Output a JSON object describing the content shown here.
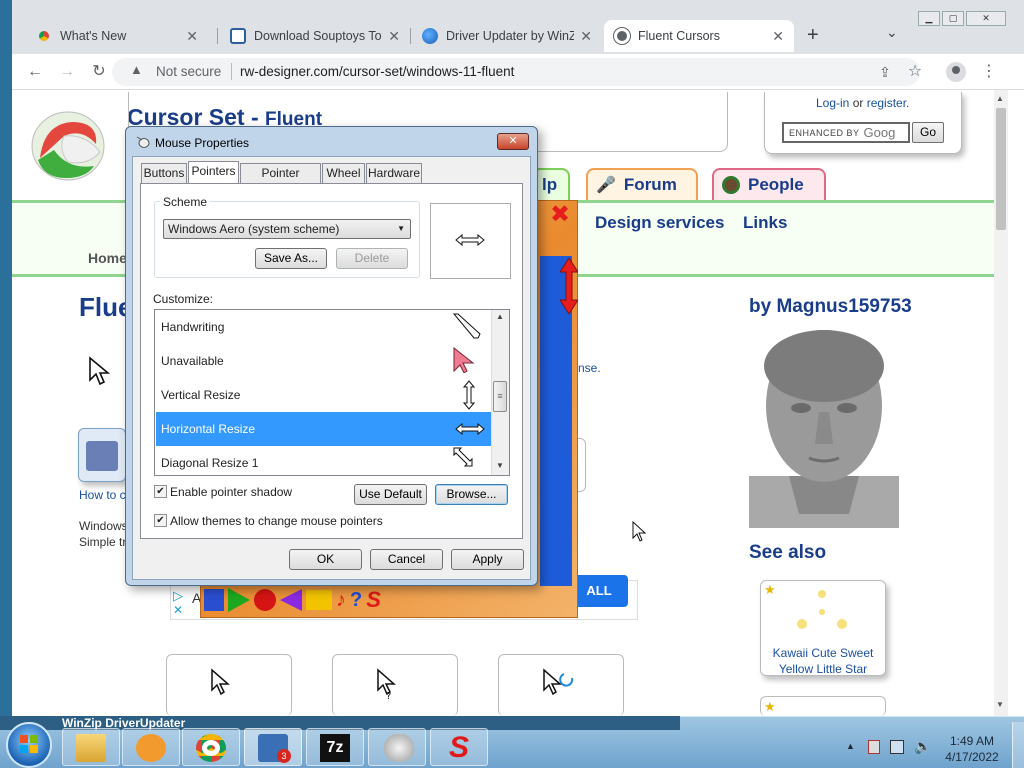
{
  "browser": {
    "tabs": [
      {
        "title": "What's New",
        "active": false
      },
      {
        "title": "Download Souptoys Toys",
        "active": false
      },
      {
        "title": "Driver Updater by WinZip",
        "active": false
      },
      {
        "title": "Fluent Cursors",
        "active": true
      }
    ],
    "new_tab": "+",
    "tab_menu": "⌄",
    "window_controls": [
      "minimize",
      "maximize",
      "close"
    ],
    "security_label": "Not secure",
    "url": "rw-designer.com/cursor-set/windows-11-fluent"
  },
  "page": {
    "site_title": "Cursor Set - ",
    "site_title_name": "Fluent",
    "login_text": "Log-in",
    "login_or": " or ",
    "register_text": "register.",
    "search_enhanced": "ENHANCED BY",
    "search_brand": "Goog",
    "search_go": "Go",
    "nav_help": "lp",
    "nav_forum": "Forum",
    "nav_people": "People",
    "nav_design": "Design services",
    "nav_links": "Links",
    "breadcrumb_home": "Home",
    "heading": "Flue",
    "license_fragment": "nse.",
    "by_label": "by ",
    "author": "Magnus159753",
    "see_also": "See also",
    "see_also_items": [
      {
        "line1": "Kawaii Cute Sweet",
        "line2": "Yellow Little Star"
      }
    ],
    "how_to": "How to c",
    "desc_line1": "Windows",
    "desc_line2": "Simple tr",
    "ad_letter": "A",
    "ad_button": "ALL"
  },
  "dialog": {
    "title": "Mouse Properties",
    "tabs": [
      "Buttons",
      "Pointers",
      "Pointer Options",
      "Wheel",
      "Hardware"
    ],
    "active_tab": "Pointers",
    "scheme_label": "Scheme",
    "scheme_value": "Windows Aero (system scheme)",
    "save_as": "Save As...",
    "delete": "Delete",
    "customize_label": "Customize:",
    "cursor_rows": [
      {
        "label": "Handwriting",
        "icon": "pen-icon"
      },
      {
        "label": "Unavailable",
        "icon": "unavailable-cursor-icon"
      },
      {
        "label": "Vertical Resize",
        "icon": "vertical-resize-icon"
      },
      {
        "label": "Horizontal Resize",
        "icon": "horizontal-resize-icon",
        "selected": true
      },
      {
        "label": "Diagonal Resize 1",
        "icon": "diagonal-resize-icon"
      }
    ],
    "shadow_label": "Enable pointer shadow",
    "shadow_checked": true,
    "themes_label": "Allow themes to change mouse pointers",
    "themes_checked": true,
    "use_default": "Use Default",
    "browse": "Browse...",
    "ok": "OK",
    "cancel": "Cancel",
    "apply": "Apply"
  },
  "taskbar": {
    "winzip_text": "WinZip DriverUpdater",
    "pinned": [
      "explorer-icon",
      "media-player-icon",
      "chrome-icon",
      "driver-updater-icon",
      "7zip-icon",
      "mouse-icon",
      "s-app-icon"
    ],
    "driver_badge": "3",
    "sevenzip_label": "7z",
    "time": "1:49 AM",
    "date": "4/17/2022"
  },
  "colors": {
    "accent_link": "#1a4fa0",
    "green_stripe": "#8fd48f",
    "selection": "#3399ff",
    "people_tab": "#e06a85",
    "forum_tab": "#f0a050",
    "help_tab": "#7bcf5a"
  }
}
